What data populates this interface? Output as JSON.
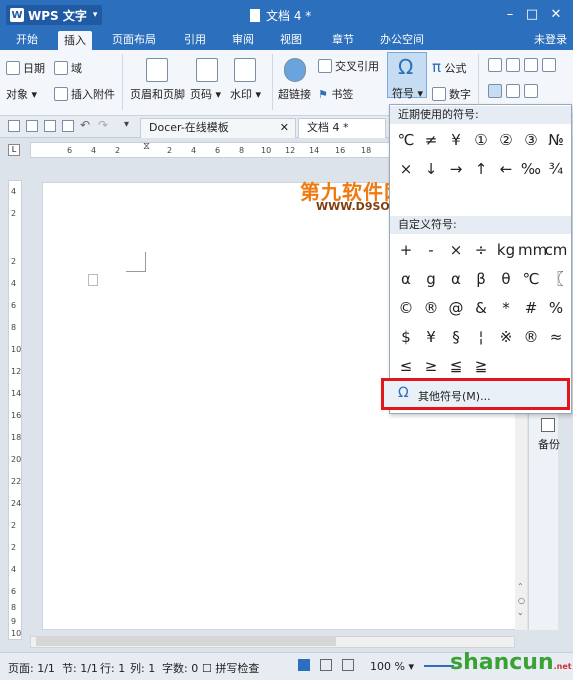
{
  "app": {
    "name": "WPS 文字",
    "document_title": "文档 4 *"
  },
  "window_controls": [
    "–",
    "□",
    "✕"
  ],
  "menu": {
    "tabs": [
      "开始",
      "插入",
      "页面布局",
      "引用",
      "审阅",
      "视图",
      "章节",
      "办公空间"
    ],
    "active": "插入",
    "right": "未登录"
  },
  "ribbon": {
    "date": "日期",
    "field": "域",
    "object": "对象",
    "attach": "插入附件",
    "header_footer": "页眉和页脚",
    "page_num": "页码",
    "watermark": "水印",
    "hyperlink": "超链接",
    "crossref": "交叉引用",
    "bookmark": "书签",
    "symbol": "符号",
    "formula": "公式",
    "number": "数字"
  },
  "doc_tabs": [
    {
      "label": "Docer-在线模板"
    },
    {
      "label": "文档 4 *"
    }
  ],
  "ruler": {
    "h_ticks": [
      "6",
      "4",
      "2",
      "2",
      "4",
      "6",
      "8",
      "10",
      "12",
      "14",
      "16",
      "18"
    ],
    "v_ticks": [
      "4",
      "2",
      "2",
      "4",
      "6",
      "8",
      "10",
      "12",
      "14",
      "16",
      "18",
      "20",
      "22",
      "24",
      "2",
      "2",
      "4",
      "6",
      "8",
      "9",
      "10"
    ]
  },
  "symbol_panel": {
    "recent_heading": "近期使用的符号:",
    "recent": [
      "℃",
      "≠",
      "¥",
      "①",
      "②",
      "③",
      "№",
      "×",
      "↓",
      "→",
      "↑",
      "←",
      "‰",
      "¾"
    ],
    "custom_heading": "自定义符号:",
    "custom": [
      "+",
      "-",
      "×",
      "÷",
      "kg",
      "mm",
      "cm",
      "α",
      "g",
      "α",
      "β",
      "θ",
      "℃",
      "〖",
      "©",
      "®",
      "@",
      "&",
      "*",
      "#",
      "%",
      "$",
      "¥",
      "§",
      "¦",
      "※",
      "®",
      "≈",
      "≤",
      "≥",
      "≦",
      "≧"
    ],
    "more_label": "其他符号(M)..."
  },
  "side_panel": {
    "backup": "备份"
  },
  "status_bar": {
    "page": "页面: 1/1",
    "section": "节: 1/1",
    "row": "行: 1",
    "col": "列: 1",
    "words": "字数: 0",
    "spell": "拼写检查",
    "zoom": "100 %"
  },
  "watermarks": {
    "top": "第九软件网",
    "url": "WWW.D9SOFT.COM",
    "bottom": "shancun",
    "bottom_tail": ".net"
  }
}
